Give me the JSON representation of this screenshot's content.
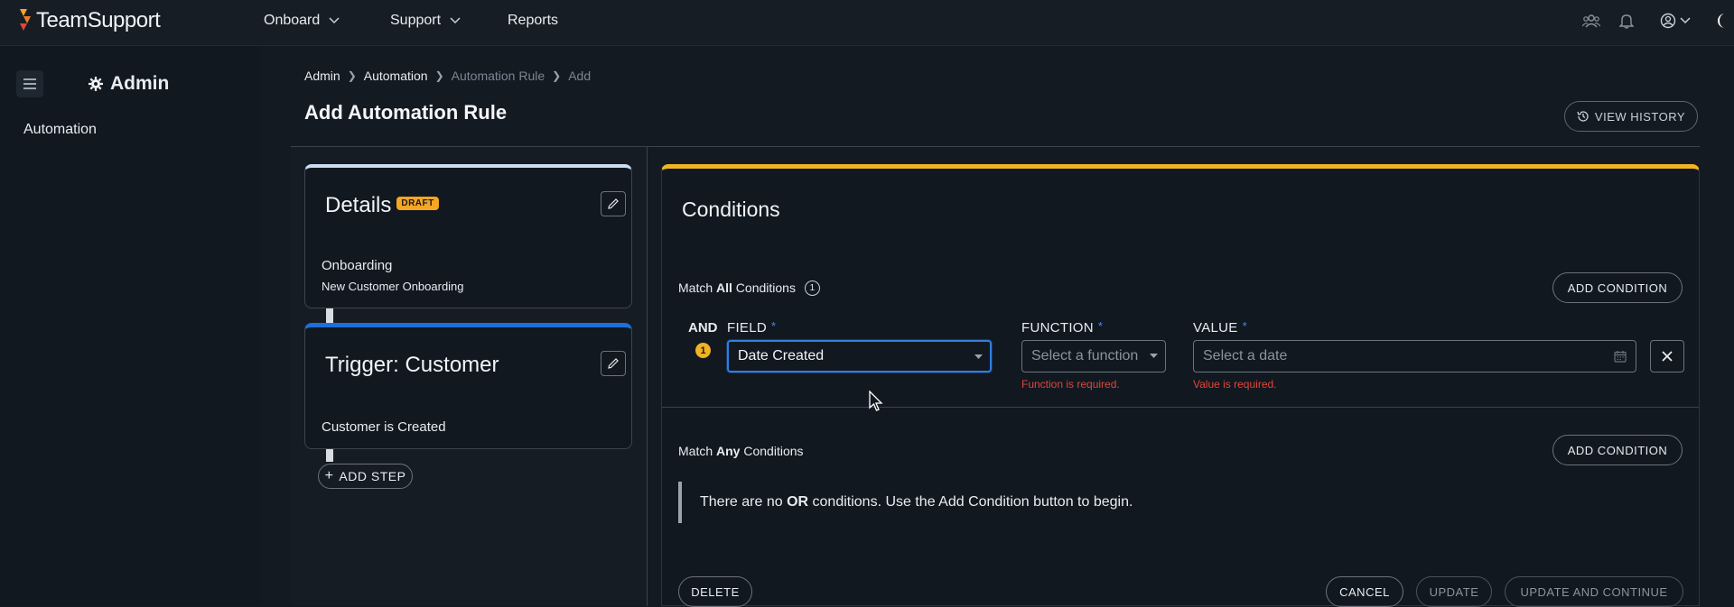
{
  "app": {
    "name": "TeamSupport"
  },
  "topnav": {
    "items": [
      {
        "label": "Onboard",
        "has_dropdown": true
      },
      {
        "label": "Support",
        "has_dropdown": true
      },
      {
        "label": "Reports",
        "has_dropdown": false
      }
    ],
    "icons": [
      "team-icon",
      "bell-icon",
      "user-account-icon",
      "chevron-down-icon",
      "dark-mode-icon"
    ]
  },
  "sidebar": {
    "title": "Admin",
    "items": [
      {
        "label": "Automation"
      }
    ]
  },
  "breadcrumb": [
    "Admin",
    "Automation",
    "Automation Rule",
    "Add"
  ],
  "page": {
    "title": "Add Automation Rule",
    "history_label": "VIEW HISTORY"
  },
  "steps": {
    "details": {
      "title": "Details",
      "badge": "DRAFT",
      "line1": "Onboarding",
      "line2": "New Customer Onboarding"
    },
    "trigger": {
      "title": "Trigger: Customer",
      "line1": "Customer is Created"
    },
    "add_step_label": "ADD STEP"
  },
  "conditions": {
    "title": "Conditions",
    "match_all": {
      "prefix": "Match",
      "bold": "All",
      "suffix": "Conditions",
      "count": "1",
      "add_label": "ADD CONDITION"
    },
    "row": {
      "operator": "AND",
      "index": "1",
      "field_label": "FIELD",
      "field_value": "Date Created",
      "function_label": "FUNCTION",
      "function_placeholder": "Select a function",
      "function_error": "Function is required.",
      "value_label": "VALUE",
      "value_placeholder": "Select a date",
      "value_error": "Value is required.",
      "required_mark": "*"
    },
    "match_any": {
      "prefix": "Match",
      "bold": "Any",
      "suffix": "Conditions",
      "add_label": "ADD CONDITION",
      "empty_before": "There are no",
      "empty_bold": "OR",
      "empty_after": "conditions. Use the Add Condition button to begin."
    }
  },
  "actions": {
    "delete": "DELETE",
    "cancel": "CANCEL",
    "update": "UPDATE",
    "update_continue": "UPDATE AND CONTINUE"
  },
  "colors": {
    "accent_blue": "#1e6fd9",
    "accent_orange": "#f0b323",
    "error": "#e0463b",
    "draft_badge": "#f5a623"
  }
}
